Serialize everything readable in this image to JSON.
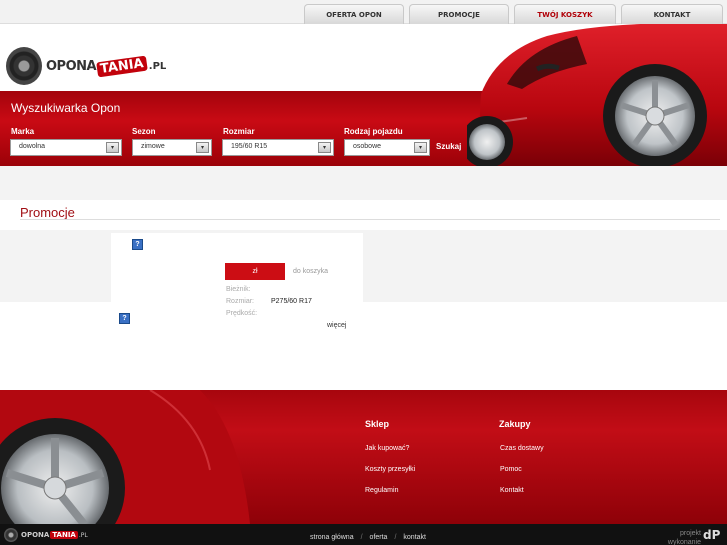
{
  "nav": {
    "tabs": [
      {
        "label": "OFERTA OPON"
      },
      {
        "label": "PROMOCJE"
      },
      {
        "label": "TWÓJ KOSZYK"
      },
      {
        "label": "KONTAKT"
      }
    ],
    "active_color": "#b00008"
  },
  "logo": {
    "part1": "OPONA",
    "part2": "TANIA",
    "part3": ".PL"
  },
  "search": {
    "title": "Wyszukiwarka Opon",
    "fields": [
      {
        "label": "Marka",
        "value": "dowolna"
      },
      {
        "label": "Sezon",
        "value": "zimowe"
      },
      {
        "label": "Rozmiar",
        "value": "195/60 R15"
      },
      {
        "label": "Rodzaj pojazdu",
        "value": "osobowe"
      }
    ],
    "button": "Szukaj"
  },
  "main": {
    "section_title": "Promocje",
    "product": {
      "price_label": "zł",
      "cart_link": "do koszyka",
      "specs": [
        {
          "label": "Bieżnik:",
          "value": ""
        },
        {
          "label": "Rozmiar:",
          "value": "P275/60 R17"
        },
        {
          "label": "Prędkość:",
          "value": ""
        }
      ],
      "more_link": "więcej",
      "help_icon_glyph": "?"
    }
  },
  "footer": {
    "col1": {
      "title": "Sklep",
      "links": [
        "Jak kupować?",
        "Koszty przesyłki",
        "Regulamin"
      ]
    },
    "col2": {
      "title": "Zakupy",
      "links": [
        "Czas dostawy",
        "Pomoc",
        "Kontakt"
      ]
    },
    "bottom_nav": [
      "strona główna",
      "oferta",
      "kontakt"
    ],
    "separator": "/",
    "credit_line1": "projekt",
    "credit_line2": "wykonanie",
    "credit_logo": "dP"
  },
  "colors": {
    "brand_red": "#c2020c",
    "band_red": "#c90a14",
    "link_red": "#a10f14"
  }
}
